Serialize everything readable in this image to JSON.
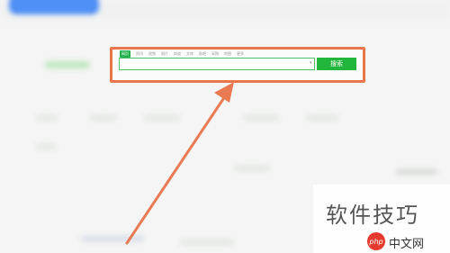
{
  "search_widget": {
    "tabs": [
      "网页",
      "资讯",
      "视频",
      "图片",
      "知道",
      "文库",
      "贴吧",
      "采购",
      "地图",
      "更多"
    ],
    "active_tab": 0,
    "input_value": "",
    "button_label": "搜索"
  },
  "watermark": {
    "title": "软件技巧",
    "badge_text": "php",
    "site_text": "中文网"
  },
  "colors": {
    "highlight_border": "#e8764a",
    "arrow": "#ea7a52",
    "button": "#22b73c",
    "input_border": "#4fbf6a",
    "logo": "#4d8ff5"
  }
}
